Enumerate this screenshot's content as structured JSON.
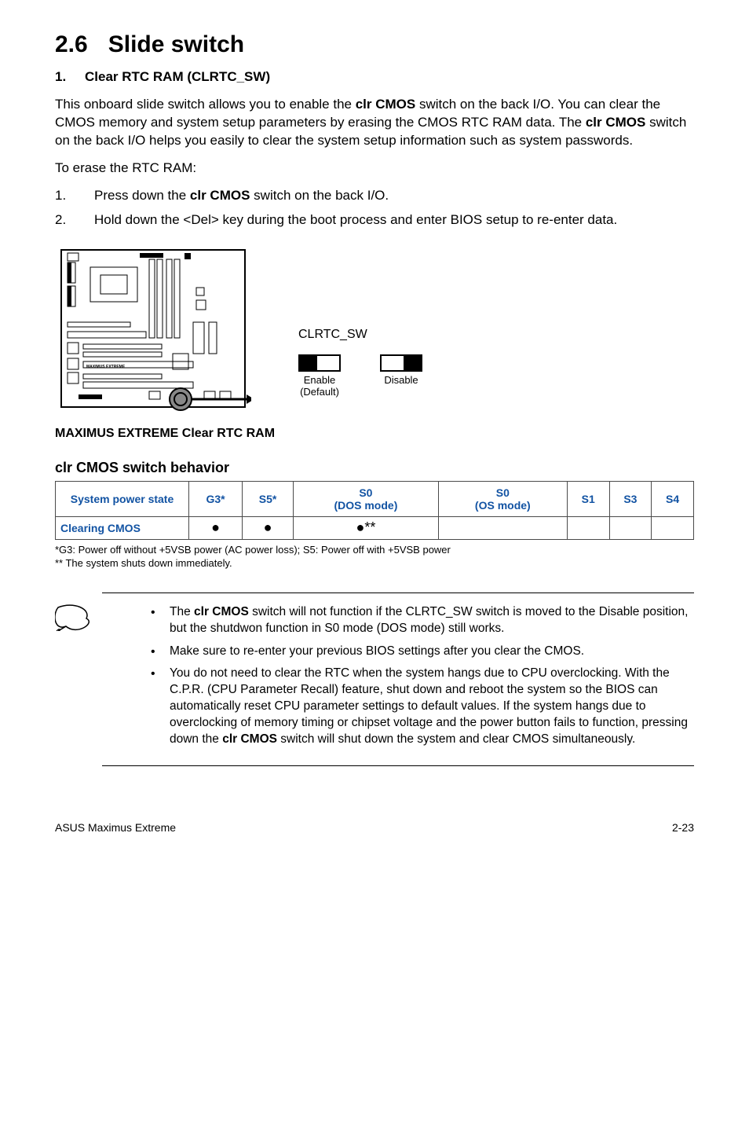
{
  "title": {
    "num": "2.6",
    "text": "Slide switch"
  },
  "item1": {
    "num": "1.",
    "title": "Clear RTC RAM (CLRTC_SW)"
  },
  "intro1": "This onboard slide switch allows you to enable the ",
  "intro1b": "clr CMOS",
  "intro1c": " switch on the back I/O. You can clear the CMOS memory and system setup parameters by erasing the CMOS RTC RAM data. The ",
  "intro1d": "clr CMOS",
  "intro1e": " switch on the back I/O helps you easily to clear the system setup information such as system passwords.",
  "intro2": "To erase the RTC RAM:",
  "steps": [
    {
      "pre": "Press down the ",
      "bold": "clr CMOS",
      "post": " switch on the back I/O."
    },
    {
      "pre": "Hold down the <Del> key during the boot process and enter BIOS setup to re-enter data.",
      "bold": "",
      "post": ""
    }
  ],
  "board_label_inside": "MAXIMUS EXTREME",
  "board_caption": "MAXIMUS EXTREME Clear RTC RAM",
  "switch": {
    "label": "CLRTC_SW",
    "enable": "Enable",
    "default": "(Default)",
    "disable": "Disable"
  },
  "behavior_title": "clr CMOS switch behavior",
  "table": {
    "headers": [
      "System power state",
      "G3*",
      "S5*",
      "S0\n(DOS mode)",
      "S0\n(OS mode)",
      "S1",
      "S3",
      "S4"
    ],
    "row_label": "Clearing CMOS",
    "cells": [
      "●",
      "●",
      "●**",
      "",
      "",
      "",
      ""
    ]
  },
  "footnotes": [
    "*G3: Power off without +5VSB power (AC power loss); S5: Power off with +5VSB power",
    "** The system shuts down immediately."
  ],
  "notes": [
    {
      "pre": "The ",
      "bold": "clr CMOS",
      "post": " switch will not function if the CLRTC_SW switch is moved to the Disable position, but the shutdwon function in S0 mode (DOS mode) still works."
    },
    {
      "pre": "Make sure to re-enter your previous BIOS settings after you clear the CMOS.",
      "bold": "",
      "post": ""
    },
    {
      "pre": "You do not need to clear the RTC when the system hangs due to CPU overclocking. With the C.P.R. (CPU Parameter Recall) feature, shut down and reboot the system so the BIOS can automatically reset CPU parameter settings to default values. If the system hangs due to overclocking of memory timing or chipset voltage and the power button fails to function, pressing down the ",
      "bold": "clr CMOS",
      "post": " switch will shut down the system and clear CMOS simultaneously."
    }
  ],
  "footer": {
    "left": "ASUS Maximus Extreme",
    "right": "2-23"
  }
}
